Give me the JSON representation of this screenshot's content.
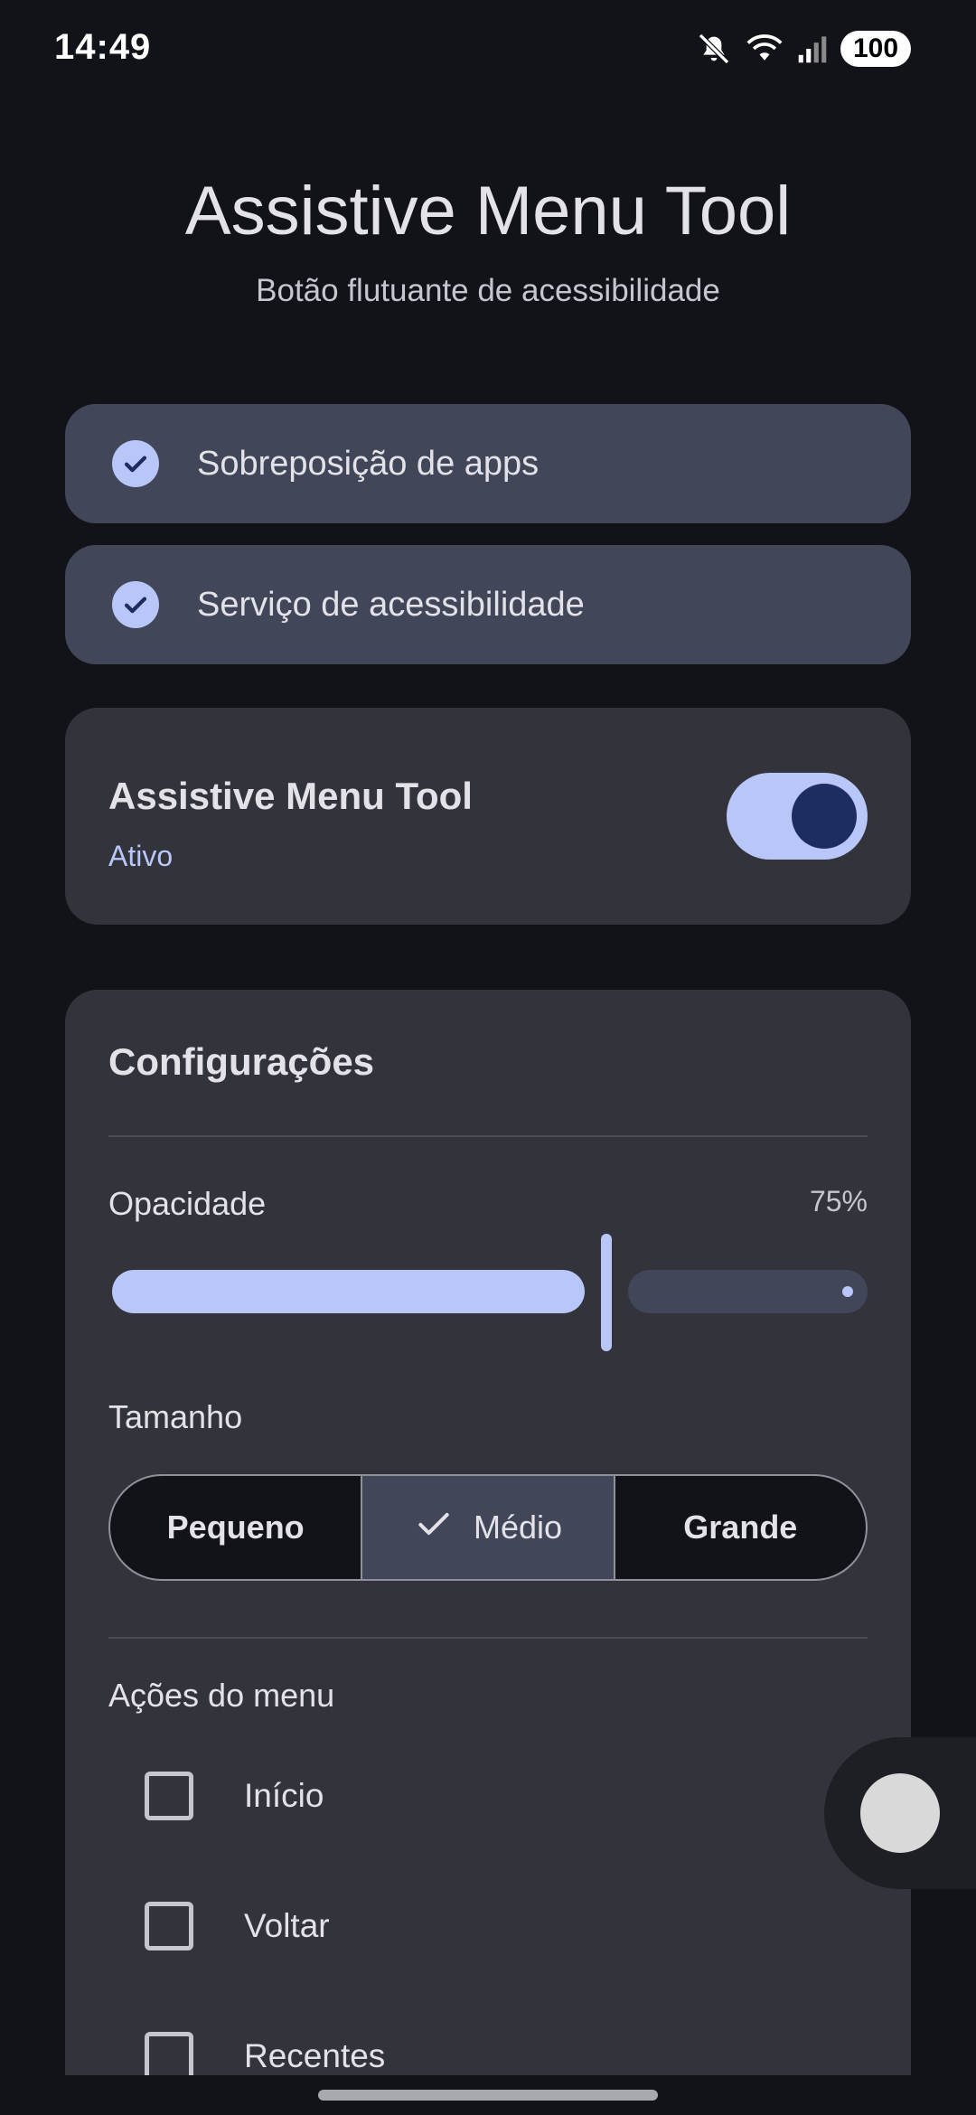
{
  "status_bar": {
    "time": "14:49",
    "battery": "100",
    "icons": [
      "mute-icon",
      "wifi-icon",
      "signal-icon"
    ]
  },
  "header": {
    "title": "Assistive Menu Tool",
    "subtitle": "Botão flutuante de acessibilidade"
  },
  "permissions": [
    {
      "label": "Sobreposição de apps",
      "granted": true
    },
    {
      "label": "Serviço de acessibilidade",
      "granted": true
    }
  ],
  "service": {
    "title": "Assistive Menu Tool",
    "status": "Ativo",
    "enabled": true
  },
  "settings": {
    "title": "Configurações",
    "opacity": {
      "label": "Opacidade",
      "value_text": "75%",
      "value": 0.75
    },
    "size": {
      "label": "Tamanho",
      "options": [
        "Pequeno",
        "Médio",
        "Grande"
      ],
      "selected": "Médio"
    },
    "actions": {
      "label": "Ações do menu",
      "items": [
        {
          "label": "Início",
          "checked": false
        },
        {
          "label": "Voltar",
          "checked": false
        },
        {
          "label": "Recentes",
          "checked": false
        }
      ]
    }
  },
  "colors": {
    "background": "#121318",
    "card": "#33343b",
    "pill": "#424659",
    "accent": "#b8c6f8",
    "accent_dark": "#1d2d61"
  }
}
